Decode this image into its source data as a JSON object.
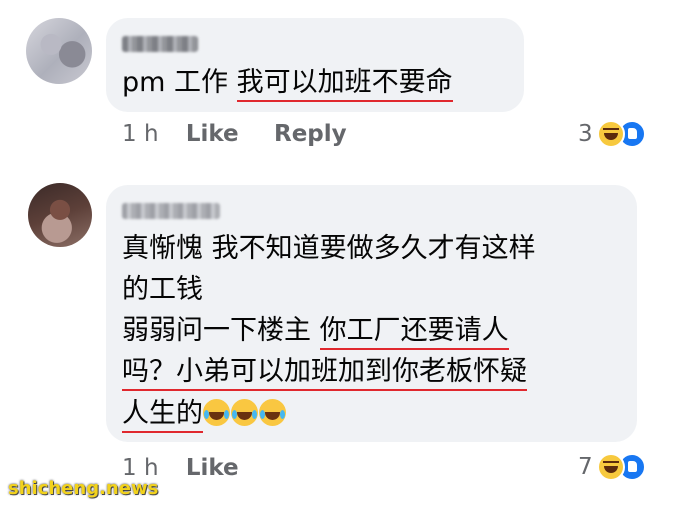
{
  "comments": [
    {
      "text": "pm 工作 ",
      "highlight": "我可以加班不要命",
      "time": "1 h",
      "like_label": "Like",
      "reply_label": "Reply",
      "reaction_count": "3",
      "reaction_icons": [
        "haha-icon",
        "like-icon"
      ]
    },
    {
      "line1": "真惭愧 我不知道要做多久才有这样",
      "line2": "的工钱",
      "line3_plain": "弱弱问一下楼主 ",
      "line3_highlight": "你工厂还要请人",
      "line4_highlight": "吗？小弟可以加班加到你老板怀疑",
      "line5_highlight": "人生的",
      "emojis": [
        "joy-emoji",
        "joy-emoji",
        "joy-emoji"
      ],
      "time": "1 h",
      "like_label": "Like",
      "reaction_count": "7",
      "reaction_icons": [
        "haha-icon",
        "like-icon"
      ]
    }
  ],
  "watermark": "shicheng.news",
  "colors": {
    "bubble": "#f0f2f5",
    "underline": "#e0282e",
    "meta_text": "#65676b",
    "like_blue": "#1877f2",
    "haha_yellow": "#f7c93e"
  }
}
